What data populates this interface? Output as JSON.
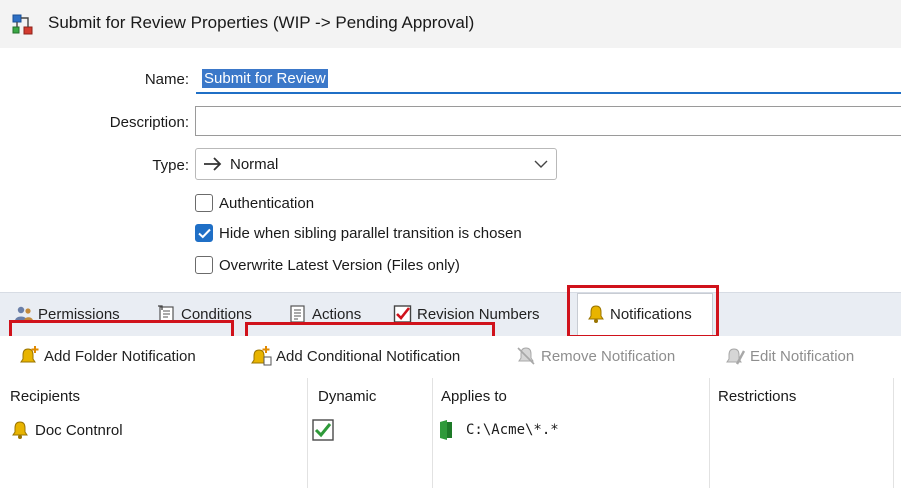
{
  "window": {
    "title": "Submit for Review Properties (WIP -> Pending Approval)"
  },
  "form": {
    "name_label": "Name:",
    "name_value": "Submit for Review",
    "description_label": "Description:",
    "description_value": "",
    "type_label": "Type:",
    "type_value": "Normal",
    "checkboxes": [
      {
        "label": "Authentication",
        "checked": false
      },
      {
        "label": "Hide when sibling parallel transition is chosen",
        "checked": true
      },
      {
        "label": "Overwrite Latest Version (Files only)",
        "checked": false
      }
    ]
  },
  "tabs": [
    {
      "label": "Permissions",
      "icon": "users-icon"
    },
    {
      "label": "Conditions",
      "icon": "conditions-icon"
    },
    {
      "label": "Actions",
      "icon": "actions-icon"
    },
    {
      "label": "Revision Numbers",
      "icon": "revision-icon"
    },
    {
      "label": "Notifications",
      "icon": "bell-icon",
      "active": true
    }
  ],
  "toolbar": {
    "add_folder": "Add Folder Notification",
    "add_conditional": "Add Conditional Notification",
    "remove": "Remove Notification",
    "edit": "Edit Notification"
  },
  "grid": {
    "columns": [
      "Recipients",
      "Dynamic",
      "Applies to",
      "Restrictions"
    ],
    "rows": [
      {
        "recipient": "Doc Contnrol",
        "dynamic": true,
        "applies_to": "C:\\Acme\\*.*",
        "restrictions": ""
      }
    ]
  },
  "colors": {
    "accent": "#1f6fc6",
    "highlight_box": "#d0121b",
    "bell": "#e8b400"
  }
}
